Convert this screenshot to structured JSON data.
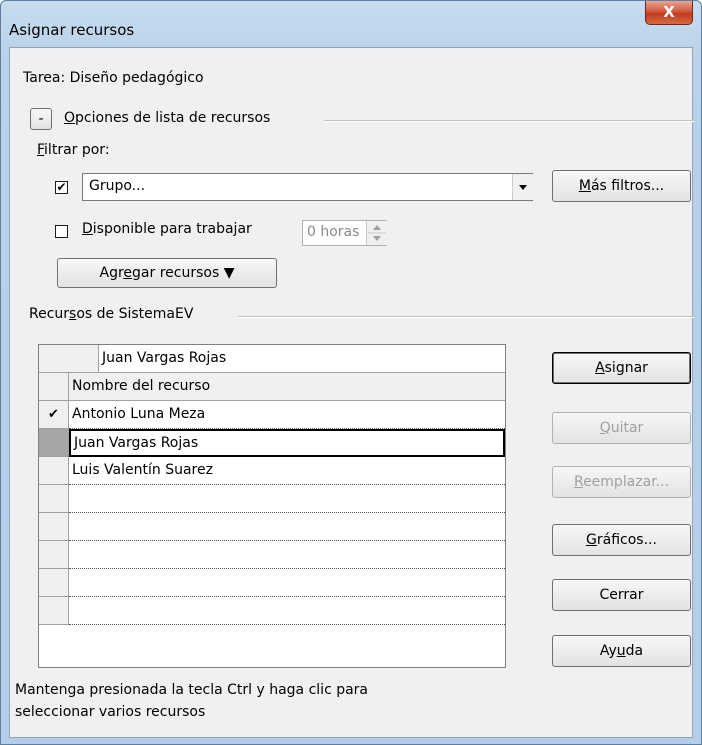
{
  "window": {
    "title": "Asignar recursos",
    "close_label": "X"
  },
  "task": {
    "label": "Tarea: Diseño pedagógico"
  },
  "options": {
    "toggle": "-",
    "group_pre": "",
    "group_u": "O",
    "group_post": "pciones de lista de recursos",
    "filter_u": "F",
    "filter_post": "iltrar por:",
    "filter_checked": "✔",
    "filter_value": "Grupo...",
    "more_filters_u": "M",
    "more_filters_post": "ás filtros...",
    "available_u": "D",
    "available_post": "isponible para trabajar",
    "hours_value": "0 horas",
    "add_pre": "Agr",
    "add_u": "e",
    "add_post": "gar recursos ▼"
  },
  "resources": {
    "group_pre": "Recur",
    "group_u": "s",
    "group_post": "os de SistemaEV",
    "edit_value": "Juan Vargas Rojas",
    "column_header": "Nombre del recurso",
    "rows": [
      {
        "mark": "✔",
        "name": "Antonio Luna Meza"
      },
      {
        "mark": "",
        "name": "Juan Vargas Rojas"
      },
      {
        "mark": "",
        "name": "Luis Valentín Suarez"
      },
      {
        "mark": "",
        "name": ""
      },
      {
        "mark": "",
        "name": ""
      },
      {
        "mark": "",
        "name": ""
      },
      {
        "mark": "",
        "name": ""
      },
      {
        "mark": "",
        "name": ""
      }
    ]
  },
  "buttons": {
    "assign_u": "A",
    "assign_post": "signar",
    "remove_u": "Q",
    "remove_post": "uitar",
    "replace_u": "R",
    "replace_post": "eemplazar...",
    "charts_u": "G",
    "charts_post": "ráficos...",
    "close": "Cerrar",
    "help_pre": "Ay",
    "help_u": "u",
    "help_post": "da"
  },
  "footer": {
    "line1": "Mantenga presionada la tecla Ctrl y haga clic para",
    "line2": "seleccionar varios recursos"
  },
  "icons": {
    "check": "check-icon",
    "dropdown": "chevron-down-icon",
    "spin": "spin-arrows-icon",
    "scroll_up": "triangle-up-icon",
    "scroll_down": "triangle-down-icon"
  }
}
